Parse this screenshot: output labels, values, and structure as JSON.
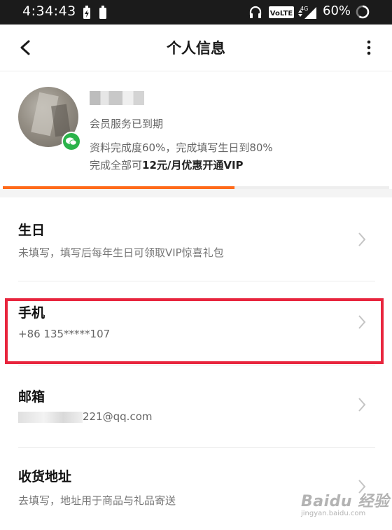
{
  "status_bar": {
    "time": "4:34:43",
    "volte": "VoLTE",
    "network": "4G",
    "battery": "60%"
  },
  "header": {
    "title": "个人信息"
  },
  "profile": {
    "membership_status": "会员服务已到期",
    "completion_text": "资料完成度60%，完成填写生日到80%",
    "promo_prefix": "完成全部可",
    "promo_bold": "12元/月优惠开通VIP",
    "completion_percent": 60
  },
  "items": [
    {
      "title": "生日",
      "subtitle": "未填写，填写后每年生日可领取VIP惊喜礼包"
    },
    {
      "title": "手机",
      "subtitle_visible": "+86 135*****107"
    },
    {
      "title": "邮箱",
      "subtitle_visible": "221@qq.com"
    },
    {
      "title": "收货地址",
      "subtitle": "去填写，地址用于商品与礼品寄送"
    }
  ],
  "watermark": {
    "main": "Baidu 经验",
    "sub": "jingyan.baidu.com"
  },
  "colors": {
    "accent": "#ff6a1a",
    "highlight": "#e8253d",
    "wechat": "#2bb34a"
  }
}
